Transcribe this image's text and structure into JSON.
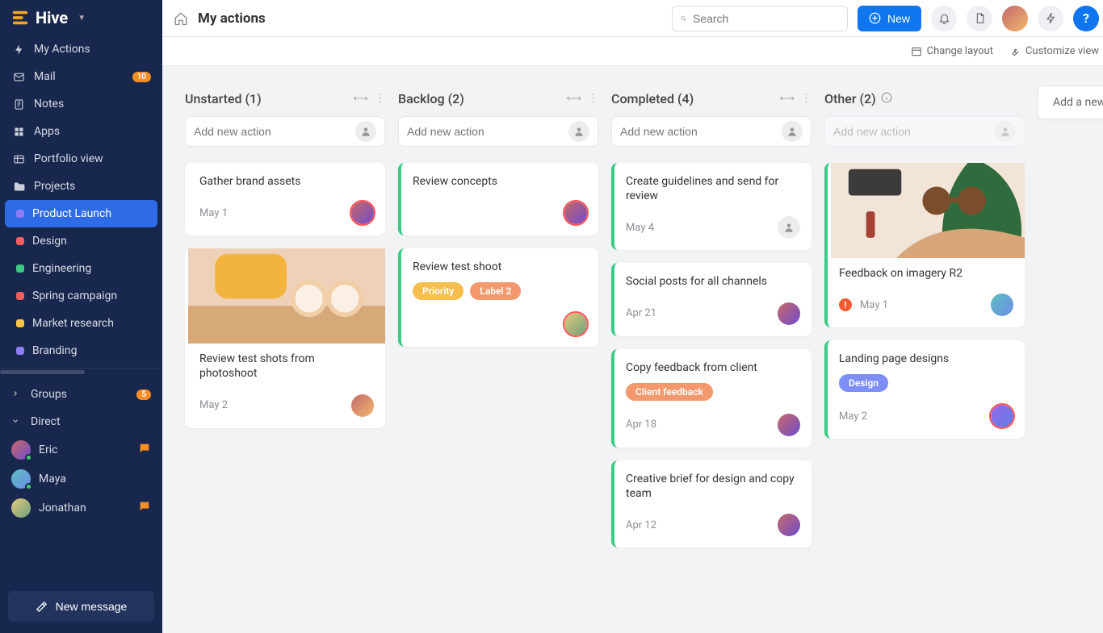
{
  "brand": "Hive",
  "header": {
    "title": "My actions",
    "search_placeholder": "Search",
    "new_button": "New"
  },
  "toolbar": {
    "change_layout": "Change layout",
    "customize_view": "Customize view"
  },
  "sidebar": {
    "nav": [
      {
        "icon": "lightning",
        "label": "My Actions"
      },
      {
        "icon": "mail",
        "label": "Mail",
        "badge": "10"
      },
      {
        "icon": "notes",
        "label": "Notes"
      },
      {
        "icon": "apps",
        "label": "Apps"
      },
      {
        "icon": "portfolio",
        "label": "Portfolio view"
      },
      {
        "icon": "folder",
        "label": "Projects"
      }
    ],
    "projects": [
      {
        "label": "Product Launch",
        "color": "#8e7df5",
        "active": true
      },
      {
        "label": "Design",
        "color": "#f05e5e"
      },
      {
        "label": "Engineering",
        "color": "#3acb86"
      },
      {
        "label": "Spring campaign",
        "color": "#f05e5e"
      },
      {
        "label": "Market research",
        "color": "#f6c748"
      },
      {
        "label": "Branding",
        "color": "#8e7df5"
      }
    ],
    "groups_label": "Groups",
    "groups_badge": "5",
    "direct_label": "Direct",
    "direct": [
      {
        "name": "Eric",
        "unread": true,
        "status": "online"
      },
      {
        "name": "Maya",
        "unread": false,
        "status": "online"
      },
      {
        "name": "Jonathan",
        "unread": true,
        "status": "offline"
      }
    ],
    "new_message": "New message"
  },
  "board": {
    "columns": [
      {
        "title": "Unstarted (1)",
        "add_placeholder": "Add new action",
        "cards": [
          {
            "title": "Gather brand assets",
            "date": "May 1",
            "avatar": "av-bg1",
            "ring": true
          },
          {
            "image": "sunglasses1",
            "title": "Review test shots from photoshoot",
            "date": "May 2",
            "avatar": "av-bg5"
          }
        ]
      },
      {
        "title": "Backlog (2)",
        "green": true,
        "add_placeholder": "Add new action",
        "cards": [
          {
            "title": "Review concepts",
            "avatar": "av-bg1",
            "ring": true
          },
          {
            "title": "Review test shoot",
            "tags": [
              {
                "text": "Priority",
                "cls": "yellow"
              },
              {
                "text": "Label 2",
                "cls": "orange"
              }
            ],
            "avatar": "av-bg2",
            "ring": true
          }
        ]
      },
      {
        "title": "Completed (4)",
        "green": true,
        "add_placeholder": "Add new action",
        "cards": [
          {
            "title": "Create guidelines and send for review",
            "date": "May 4",
            "avatar": "default"
          },
          {
            "title": "Social posts for all channels",
            "date": "Apr 21",
            "avatar": "av-bg1"
          },
          {
            "title": "Copy feedback from client",
            "tags": [
              {
                "text": "Client feedback",
                "cls": "orange"
              }
            ],
            "date": "Apr 18",
            "avatar": "av-bg1"
          },
          {
            "title": "Creative brief for design and copy team",
            "date": "Apr 12",
            "avatar": "av-bg1"
          }
        ]
      },
      {
        "title": "Other (2)",
        "info": true,
        "green": true,
        "add_placeholder": "Add new action",
        "add_disabled": true,
        "cards": [
          {
            "image": "sunglasses2",
            "title": "Feedback on imagery R2",
            "date": "May 1",
            "exclaim": true,
            "avatar": "av-bg4"
          },
          {
            "title": "Landing page designs",
            "tags": [
              {
                "text": "Design",
                "cls": "blue"
              }
            ],
            "date": "May 2",
            "avatar": "av-bg3",
            "ring": true
          }
        ]
      }
    ],
    "add_column": "Add a new"
  }
}
